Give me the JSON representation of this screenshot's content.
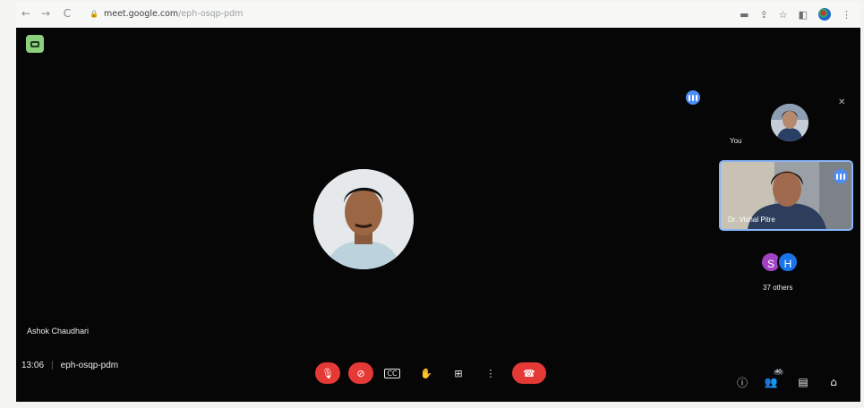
{
  "browser": {
    "url_host": "meet.google.com",
    "url_path": "/eph-osqp-pdm",
    "back_glyph": "←",
    "forward_glyph": "→",
    "reload_glyph": "C",
    "lock_glyph": "🔒",
    "right_icons": [
      "cast-icon",
      "share-icon",
      "star-icon",
      "sidebar-icon",
      "profile-icon",
      "menu-icon"
    ]
  },
  "meet": {
    "main_participant_name": "Ashok Chaudhari",
    "self_label": "You",
    "pinned_participant_name": "Dr. Vishal Pitre",
    "others_avatars": [
      "S",
      "H"
    ],
    "others_colors": [
      "#a142c4",
      "#1a73e8"
    ],
    "others_count_label": "37 others",
    "time": "13:06",
    "meeting_code": "eph-osqp-pdm",
    "people_count": "40"
  },
  "colors": {
    "meet_bg": "#060606",
    "danger": "#e53935",
    "accent": "#4e8df5",
    "logo_green": "#8ccf7e"
  },
  "controls": [
    {
      "name": "mic-off-button",
      "icon": "mic-off-icon",
      "glyph": "🎙",
      "style": "red"
    },
    {
      "name": "camera-off-button",
      "icon": "camera-off-icon",
      "glyph": "⊘",
      "style": "red"
    },
    {
      "name": "captions-button",
      "icon": "captions-icon",
      "glyph": "CC",
      "style": "dark"
    },
    {
      "name": "raise-hand-button",
      "icon": "hand-icon",
      "glyph": "✋",
      "style": "dark"
    },
    {
      "name": "present-button",
      "icon": "present-icon",
      "glyph": "⊞",
      "style": "dark"
    },
    {
      "name": "more-options-button",
      "icon": "more-vert-icon",
      "glyph": "⋮",
      "style": "dark"
    },
    {
      "name": "leave-call-button",
      "icon": "end-call-icon",
      "glyph": "☎",
      "style": "end"
    }
  ]
}
